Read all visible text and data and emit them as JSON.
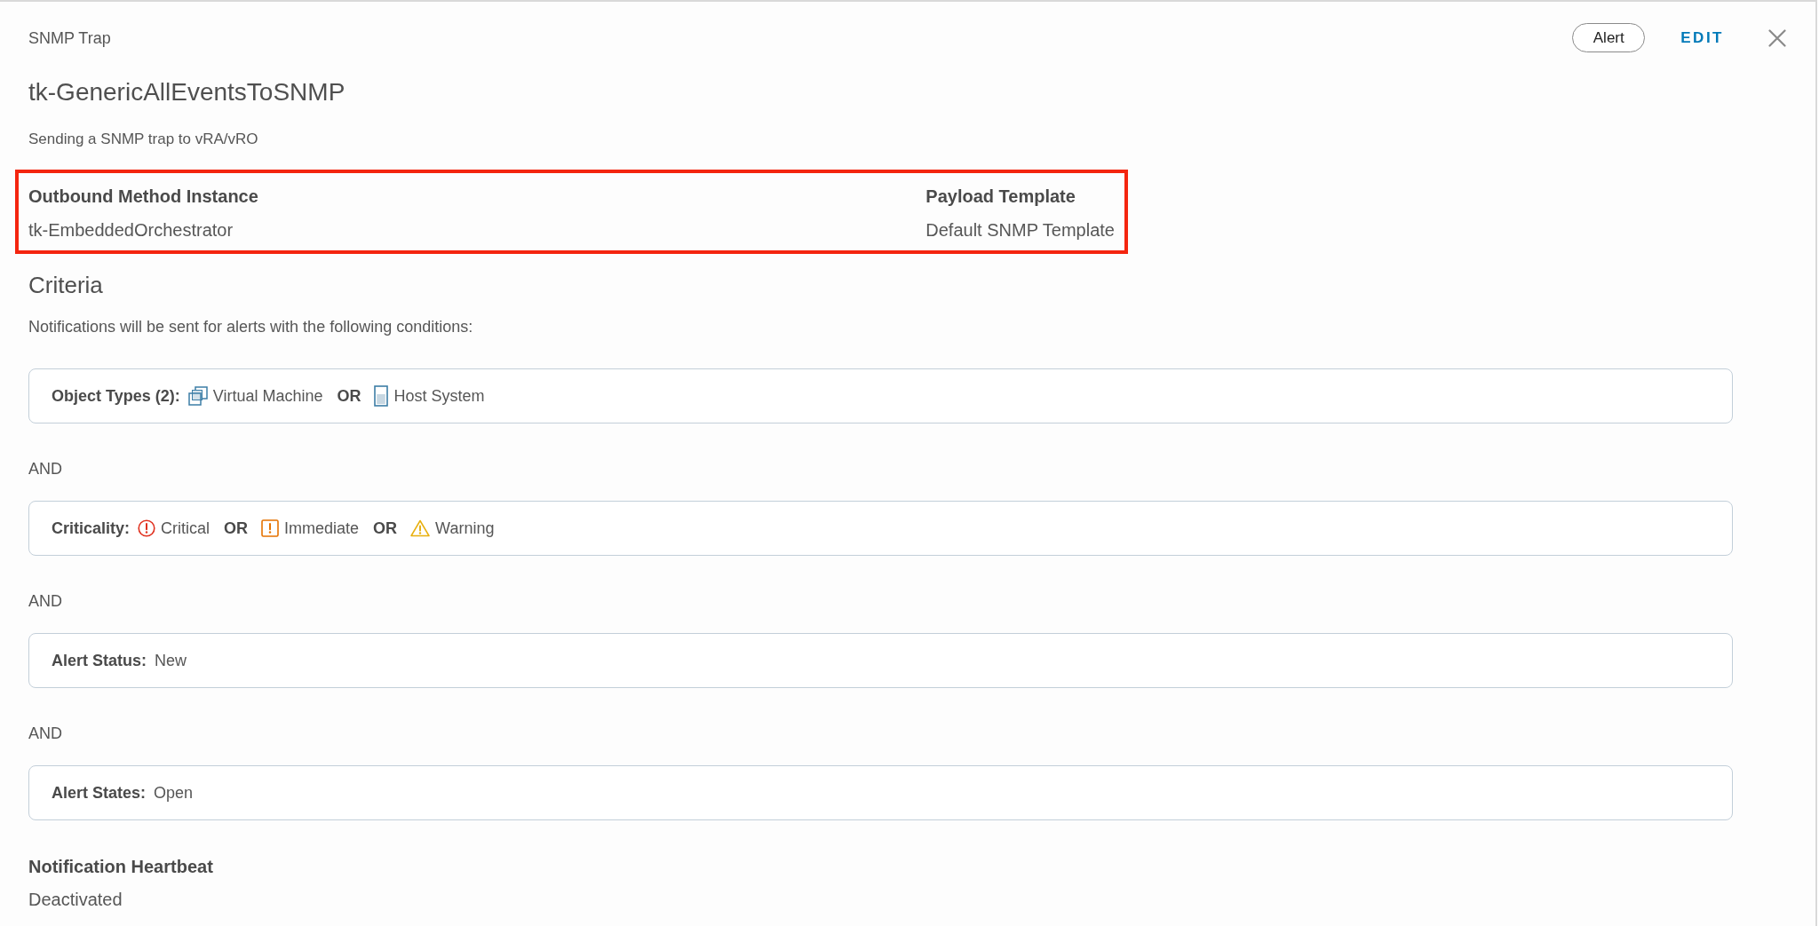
{
  "header": {
    "type_label": "SNMP Trap",
    "tag": "Alert",
    "edit": "EDIT"
  },
  "title": "tk-GenericAllEventsToSNMP",
  "description": "Sending a SNMP trap to vRA/vRO",
  "highlight": {
    "fields": [
      {
        "label": "Outbound Method Instance",
        "value": "tk-EmbeddedOrchestrator"
      },
      {
        "label": "Payload Template",
        "value": "Default SNMP Template"
      }
    ]
  },
  "criteria": {
    "heading": "Criteria",
    "intro": "Notifications will be sent for alerts with the following conditions:",
    "items": [
      {
        "kind": "condition",
        "label": "Object Types (2):",
        "terms": [
          {
            "kind": "vm",
            "text": "Virtual Machine"
          },
          {
            "kind": "operator",
            "text": "OR"
          },
          {
            "kind": "host",
            "text": "Host System"
          }
        ]
      },
      {
        "kind": "joiner",
        "text": "AND"
      },
      {
        "kind": "condition",
        "label": "Criticality:",
        "terms": [
          {
            "kind": "critical",
            "text": "Critical"
          },
          {
            "kind": "operator",
            "text": "OR"
          },
          {
            "kind": "immediate",
            "text": "Immediate"
          },
          {
            "kind": "operator",
            "text": "OR"
          },
          {
            "kind": "warning",
            "text": "Warning"
          }
        ]
      },
      {
        "kind": "joiner",
        "text": "AND"
      },
      {
        "kind": "condition",
        "label": "Alert Status:",
        "terms": [
          {
            "kind": "plain",
            "text": "New"
          }
        ]
      },
      {
        "kind": "joiner",
        "text": "AND"
      },
      {
        "kind": "condition",
        "label": "Alert States:",
        "terms": [
          {
            "kind": "plain",
            "text": "Open"
          }
        ]
      }
    ]
  },
  "heartbeat": {
    "label": "Notification Heartbeat",
    "value": "Deactivated"
  }
}
